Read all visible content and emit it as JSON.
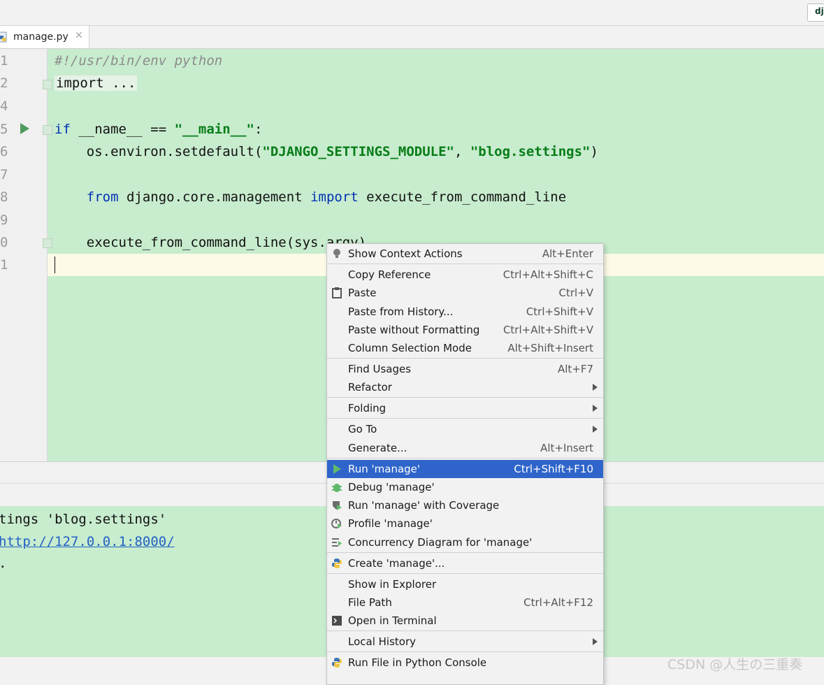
{
  "toolbar": {
    "django_button": "dj"
  },
  "tab": {
    "label": "manage.py",
    "close": "✕"
  },
  "editor": {
    "line_numbers": [
      "1",
      "2",
      "4",
      "5",
      "6",
      "7",
      "8",
      "9",
      "0",
      "1"
    ],
    "lines": {
      "l1": "#!/usr/bin/env python",
      "l2": "import ...",
      "l5_kw": "if",
      "l5_mid": " __name__ == ",
      "l5_str": "\"__main__\"",
      "l5_end": ":",
      "l6_a": "    os.environ.setdefault(",
      "l6_s1": "\"DJANGO_SETTINGS_MODULE\"",
      "l6_b": ", ",
      "l6_s2": "\"blog.settings\"",
      "l6_c": ")",
      "l8_kw1": "from",
      "l8_mid": " django.core.management ",
      "l8_kw2": "import",
      "l8_end": " execute_from_command_line",
      "l10": "    execute_from_command_line(sys.argv)"
    }
  },
  "console": {
    "line1": "tings 'blog.settings'",
    "link": "http://127.0.0.1:8000/",
    "line3": "."
  },
  "watermark": "CSDN @人生の三重奏",
  "menu": {
    "items": [
      {
        "label": "Show Context Actions",
        "shortcut": "Alt+Enter",
        "icon": "lightbulb-icon"
      },
      {
        "label": "Copy Reference",
        "shortcut": "Ctrl+Alt+Shift+C"
      },
      {
        "label": "Paste",
        "shortcut": "Ctrl+V",
        "icon": "clipboard-icon"
      },
      {
        "label": "Paste from History...",
        "shortcut": "Ctrl+Shift+V"
      },
      {
        "label": "Paste without Formatting",
        "shortcut": "Ctrl+Alt+Shift+V"
      },
      {
        "label": "Column Selection Mode",
        "shortcut": "Alt+Shift+Insert"
      },
      {
        "label": "Find Usages",
        "shortcut": "Alt+F7"
      },
      {
        "label": "Refactor",
        "shortcut": ""
      },
      {
        "label": "Folding",
        "shortcut": ""
      },
      {
        "label": "Go To",
        "shortcut": ""
      },
      {
        "label": "Generate...",
        "shortcut": "Alt+Insert"
      },
      {
        "label": "Run 'manage'",
        "shortcut": "Ctrl+Shift+F10",
        "icon": "run-icon"
      },
      {
        "label": "Debug 'manage'",
        "shortcut": "",
        "icon": "bug-icon"
      },
      {
        "label": "Run 'manage' with Coverage",
        "shortcut": "",
        "icon": "coverage-icon"
      },
      {
        "label": "Profile 'manage'",
        "shortcut": "",
        "icon": "profile-icon"
      },
      {
        "label": "Concurrency Diagram for 'manage'",
        "shortcut": "",
        "icon": "concurrency-icon"
      },
      {
        "label": "Create 'manage'...",
        "shortcut": "",
        "icon": "python-icon"
      },
      {
        "label": "Show in Explorer",
        "shortcut": ""
      },
      {
        "label": "File Path",
        "shortcut": "Ctrl+Alt+F12"
      },
      {
        "label": "Open in Terminal",
        "shortcut": "",
        "icon": "terminal-icon"
      },
      {
        "label": "Local History",
        "shortcut": ""
      },
      {
        "label": "Run File in Python Console",
        "shortcut": "",
        "icon": "python-icon"
      }
    ]
  },
  "colors": {
    "editor_bg": "#c8ecce",
    "selection": "#2f65ca",
    "keyword": "#0033b3",
    "string": "#067d17"
  }
}
